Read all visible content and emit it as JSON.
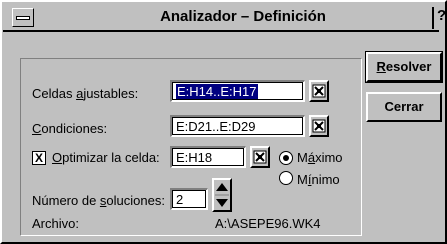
{
  "window": {
    "title": "Analizador – Definición",
    "help_glyph": "?"
  },
  "form": {
    "adjustable_label_pre": "Celdas ",
    "adjustable_label_key": "a",
    "adjustable_label_post": "justables:",
    "adjustable_value": "E:H14..E:H17",
    "conditions_label_key": "C",
    "conditions_label_post": "ondiciones:",
    "conditions_value": "E:D21..E:D29",
    "optimize_check": "X",
    "optimize_label_key": "O",
    "optimize_label_post": "ptimizar la celda:",
    "optimize_value": "E:H18",
    "max_label_pre": "M",
    "max_label_key": "á",
    "max_label_post": "ximo",
    "min_label_pre": "M",
    "min_label_key": "í",
    "min_label_post": "nimo",
    "solutions_label_pre": "Número de ",
    "solutions_label_key": "s",
    "solutions_label_post": "oluciones:",
    "solutions_value": "2",
    "file_label": "Archivo:",
    "file_value": "A:\\ASEPE96.WK4"
  },
  "buttons": {
    "resolve_key": "R",
    "resolve_post": "esolver",
    "close": "Cerrar"
  }
}
